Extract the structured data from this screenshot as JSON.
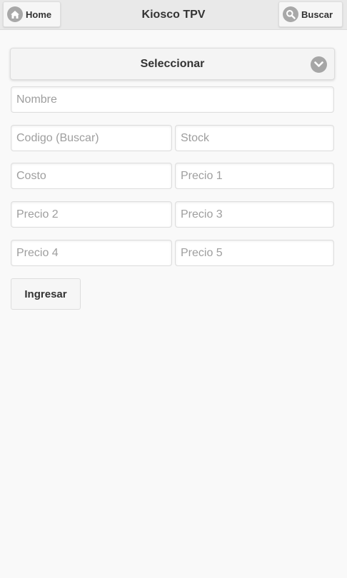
{
  "header": {
    "title": "Kiosco TPV",
    "home_label": "Home",
    "search_label": "Buscar"
  },
  "form": {
    "select_label": "Seleccionar",
    "fields": {
      "nombre": "Nombre",
      "codigo": "Codigo (Buscar)",
      "stock": "Stock",
      "costo": "Costo",
      "precio1": "Precio 1",
      "precio2": "Precio 2",
      "precio3": "Precio 3",
      "precio4": "Precio 4",
      "precio5": "Precio 5"
    },
    "submit_label": "Ingresar"
  },
  "colors": {
    "header_bg": "#e9e9e9",
    "page_bg": "#f9f9f9",
    "icon_gray": "#a8a8a8"
  },
  "icons": {
    "home": "home-icon",
    "search": "search-icon",
    "select": "chevron-down-icon"
  }
}
